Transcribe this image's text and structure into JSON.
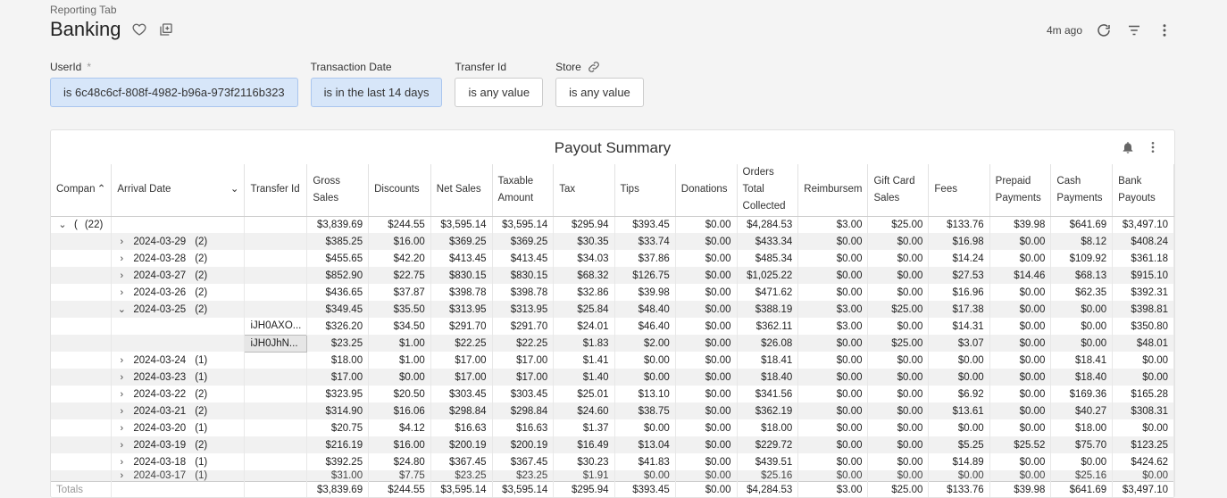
{
  "breadcrumb": "Reporting Tab",
  "title": "Banking",
  "updated": "4m ago",
  "filters": [
    {
      "label": "UserId",
      "required": "*",
      "value": "is 6c48c6cf-808f-4982-b96a-973f2116b323",
      "active": true
    },
    {
      "label": "Transaction Date",
      "value": "is in the last 14 days",
      "active": true
    },
    {
      "label": "Transfer Id",
      "value": "is any value",
      "active": false
    },
    {
      "label": "Store",
      "value": "is any value",
      "active": false
    }
  ],
  "table": {
    "title": "Payout Summary",
    "columns": [
      "Compan",
      "Arrival Date",
      "Transfer Id",
      "Gross Sales",
      "Discounts",
      "Net Sales",
      "Taxable Amount",
      "Tax",
      "Tips",
      "Donations",
      "Orders Total Collected",
      "Reimbursem",
      "Gift Card Sales",
      "Fees",
      "Prepaid Payments",
      "Cash Payments",
      "Bank Payouts"
    ],
    "group": {
      "company": "(",
      "count": "(22)",
      "values": [
        "$3,839.69",
        "$244.55",
        "$3,595.14",
        "$3,595.14",
        "$295.94",
        "$393.45",
        "$0.00",
        "$4,284.53",
        "$3.00",
        "$25.00",
        "$133.76",
        "$39.98",
        "$641.69",
        "$3,497.10"
      ]
    },
    "rows": [
      {
        "date": "2024-03-29",
        "count": "(2)",
        "values": [
          "$385.25",
          "$16.00",
          "$369.25",
          "$369.25",
          "$30.35",
          "$33.74",
          "$0.00",
          "$433.34",
          "$0.00",
          "$0.00",
          "$16.98",
          "$0.00",
          "$8.12",
          "$408.24"
        ]
      },
      {
        "date": "2024-03-28",
        "count": "(2)",
        "values": [
          "$455.65",
          "$42.20",
          "$413.45",
          "$413.45",
          "$34.03",
          "$37.86",
          "$0.00",
          "$485.34",
          "$0.00",
          "$0.00",
          "$14.24",
          "$0.00",
          "$109.92",
          "$361.18"
        ]
      },
      {
        "date": "2024-03-27",
        "count": "(2)",
        "values": [
          "$852.90",
          "$22.75",
          "$830.15",
          "$830.15",
          "$68.32",
          "$126.75",
          "$0.00",
          "$1,025.22",
          "$0.00",
          "$0.00",
          "$27.53",
          "$14.46",
          "$68.13",
          "$915.10"
        ]
      },
      {
        "date": "2024-03-26",
        "count": "(2)",
        "values": [
          "$436.65",
          "$37.87",
          "$398.78",
          "$398.78",
          "$32.86",
          "$39.98",
          "$0.00",
          "$471.62",
          "$0.00",
          "$0.00",
          "$16.96",
          "$0.00",
          "$62.35",
          "$392.31"
        ]
      },
      {
        "date": "2024-03-25",
        "count": "(2)",
        "expanded": true,
        "values": [
          "$349.45",
          "$35.50",
          "$313.95",
          "$313.95",
          "$25.84",
          "$48.40",
          "$0.00",
          "$388.19",
          "$3.00",
          "$25.00",
          "$17.38",
          "$0.00",
          "$0.00",
          "$398.81"
        ]
      },
      {
        "transfer": "iJH0AXO...",
        "values": [
          "$326.20",
          "$34.50",
          "$291.70",
          "$291.70",
          "$24.01",
          "$46.40",
          "$0.00",
          "$362.11",
          "$3.00",
          "$0.00",
          "$14.31",
          "$0.00",
          "$0.00",
          "$350.80"
        ]
      },
      {
        "transfer": "iJH0JhN...",
        "selected": true,
        "values": [
          "$23.25",
          "$1.00",
          "$22.25",
          "$22.25",
          "$1.83",
          "$2.00",
          "$0.00",
          "$26.08",
          "$0.00",
          "$25.00",
          "$3.07",
          "$0.00",
          "$0.00",
          "$48.01"
        ]
      },
      {
        "date": "2024-03-24",
        "count": "(1)",
        "values": [
          "$18.00",
          "$1.00",
          "$17.00",
          "$17.00",
          "$1.41",
          "$0.00",
          "$0.00",
          "$18.41",
          "$0.00",
          "$0.00",
          "$0.00",
          "$0.00",
          "$18.41",
          "$0.00"
        ]
      },
      {
        "date": "2024-03-23",
        "count": "(1)",
        "values": [
          "$17.00",
          "$0.00",
          "$17.00",
          "$17.00",
          "$1.40",
          "$0.00",
          "$0.00",
          "$18.40",
          "$0.00",
          "$0.00",
          "$0.00",
          "$0.00",
          "$18.40",
          "$0.00"
        ]
      },
      {
        "date": "2024-03-22",
        "count": "(2)",
        "values": [
          "$323.95",
          "$20.50",
          "$303.45",
          "$303.45",
          "$25.01",
          "$13.10",
          "$0.00",
          "$341.56",
          "$0.00",
          "$0.00",
          "$6.92",
          "$0.00",
          "$169.36",
          "$165.28"
        ]
      },
      {
        "date": "2024-03-21",
        "count": "(2)",
        "values": [
          "$314.90",
          "$16.06",
          "$298.84",
          "$298.84",
          "$24.60",
          "$38.75",
          "$0.00",
          "$362.19",
          "$0.00",
          "$0.00",
          "$13.61",
          "$0.00",
          "$40.27",
          "$308.31"
        ]
      },
      {
        "date": "2024-03-20",
        "count": "(1)",
        "values": [
          "$20.75",
          "$4.12",
          "$16.63",
          "$16.63",
          "$1.37",
          "$0.00",
          "$0.00",
          "$18.00",
          "$0.00",
          "$0.00",
          "$0.00",
          "$0.00",
          "$18.00",
          "$0.00"
        ]
      },
      {
        "date": "2024-03-19",
        "count": "(2)",
        "values": [
          "$216.19",
          "$16.00",
          "$200.19",
          "$200.19",
          "$16.49",
          "$13.04",
          "$0.00",
          "$229.72",
          "$0.00",
          "$0.00",
          "$5.25",
          "$25.52",
          "$75.70",
          "$123.25"
        ]
      },
      {
        "date": "2024-03-18",
        "count": "(1)",
        "values": [
          "$392.25",
          "$24.80",
          "$367.45",
          "$367.45",
          "$30.23",
          "$41.83",
          "$0.00",
          "$439.51",
          "$0.00",
          "$0.00",
          "$14.89",
          "$0.00",
          "$0.00",
          "$424.62"
        ]
      },
      {
        "date": "2024-03-17",
        "count": "(1)",
        "clipped": true,
        "values": [
          "$31.00",
          "$7.75",
          "$23.25",
          "$23.25",
          "$1.91",
          "$0.00",
          "$0.00",
          "$25.16",
          "$0.00",
          "$0.00",
          "$0.00",
          "$0.00",
          "$25.16",
          "$0.00"
        ]
      }
    ],
    "totals_label": "Totals",
    "totals": [
      "$3,839.69",
      "$244.55",
      "$3,595.14",
      "$3,595.14",
      "$295.94",
      "$393.45",
      "$0.00",
      "$4,284.53",
      "$3.00",
      "$25.00",
      "$133.76",
      "$39.98",
      "$641.69",
      "$3,497.10"
    ]
  }
}
